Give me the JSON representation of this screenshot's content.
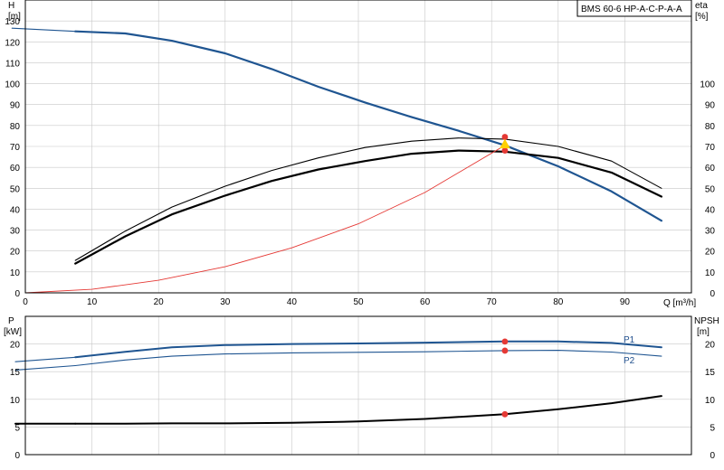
{
  "model_label": "BMS 60-6 HP-A-C-P-A-A",
  "colors": {
    "head": "#1f5591",
    "power": "#1f5591",
    "eta": "#000000",
    "npsh": "#000000",
    "system": "#e53935",
    "grid": "#c8c8c8",
    "duty_point": "#e53935",
    "duty_highlight": "#ffd000"
  },
  "chart_data": [
    {
      "type": "line",
      "title": "",
      "x_label": "Q [m³/h]",
      "y_label_left": "H\n[m]",
      "y_label_right": "eta\n[%]",
      "xlim": [
        0,
        100
      ],
      "ylim_left": [
        0,
        140
      ],
      "ylim_right": [
        0,
        140
      ],
      "x_ticks": [
        0,
        10,
        20,
        30,
        40,
        50,
        60,
        70,
        80,
        90
      ],
      "y_ticks_left": [
        0,
        10,
        20,
        30,
        40,
        50,
        60,
        70,
        80,
        90,
        100,
        110,
        120,
        130
      ],
      "y_ticks_right": [
        0,
        10,
        20,
        30,
        40,
        50,
        60,
        70,
        80,
        90,
        100
      ],
      "grid": true,
      "series": [
        {
          "key": "head_extended",
          "axis": "left",
          "style": "head_thin",
          "x": [
            -2,
            7.5
          ],
          "y": [
            126.5,
            125
          ]
        },
        {
          "key": "head",
          "axis": "left",
          "style": "head",
          "x": [
            7.5,
            15,
            22,
            30,
            37,
            44,
            51,
            58,
            65,
            72,
            80,
            88,
            95.5
          ],
          "y": [
            125,
            124,
            120.5,
            114.5,
            107,
            98.5,
            91,
            84,
            77.5,
            70.5,
            60.5,
            48.5,
            34.5
          ]
        },
        {
          "key": "eta_upper",
          "axis": "right",
          "style": "eta_thin",
          "x": [
            7.5,
            15,
            22,
            30,
            37,
            44,
            51,
            58,
            65,
            72,
            80,
            88,
            95.5
          ],
          "y": [
            15.5,
            29.5,
            41,
            51,
            58.5,
            64.5,
            69.5,
            72.5,
            74,
            73.5,
            70,
            63,
            50
          ]
        },
        {
          "key": "eta_lower",
          "axis": "right",
          "style": "eta",
          "x": [
            7.5,
            15,
            22,
            30,
            37,
            44,
            51,
            58,
            65,
            72,
            80,
            88,
            95.5
          ],
          "y": [
            14,
            27,
            37.5,
            46.5,
            53.5,
            59,
            63,
            66.5,
            68,
            67.5,
            64.5,
            57.5,
            46
          ]
        },
        {
          "key": "system",
          "axis": "left",
          "style": "system",
          "x": [
            0,
            10,
            20,
            30,
            40,
            50,
            60,
            72
          ],
          "y": [
            0,
            1.7,
            6,
            12.5,
            21.5,
            33,
            48,
            70.5
          ]
        }
      ],
      "points": [
        {
          "axis": "left",
          "x": 72,
          "y": 74.5,
          "style": "duty"
        },
        {
          "axis": "left",
          "x": 72,
          "y": 68,
          "style": "duty"
        },
        {
          "axis": "left",
          "x": 72,
          "y": 71,
          "style": "duty_highlight"
        }
      ]
    },
    {
      "type": "line",
      "title": "",
      "x_label": "",
      "y_label_left": "P\n[kW]",
      "y_label_right": "NPSH\n[m]",
      "xlim": [
        0,
        100
      ],
      "ylim_left": [
        0,
        25
      ],
      "ylim_right": [
        0,
        25
      ],
      "y_ticks_left": [
        0,
        5,
        10,
        15,
        20
      ],
      "y_ticks_right": [
        0,
        5,
        10,
        15,
        20
      ],
      "grid": true,
      "series": [
        {
          "key": "p1_extended",
          "axis": "left",
          "style": "power_thin",
          "x": [
            -1.5,
            7.5
          ],
          "y": [
            16.8,
            17.6
          ]
        },
        {
          "key": "p1",
          "axis": "left",
          "style": "power",
          "name": "P1",
          "x": [
            7.5,
            15,
            22,
            30,
            40,
            50,
            60,
            72,
            80,
            88,
            95.5
          ],
          "y": [
            17.6,
            18.6,
            19.4,
            19.8,
            20,
            20.1,
            20.25,
            20.45,
            20.45,
            20.2,
            19.4
          ]
        },
        {
          "key": "p2_extended",
          "axis": "left",
          "style": "power_thin",
          "x": [
            -1.5,
            7.5
          ],
          "y": [
            15.3,
            16.1
          ]
        },
        {
          "key": "p2",
          "axis": "left",
          "style": "power_thin",
          "name": "P2",
          "x": [
            7.5,
            15,
            22,
            30,
            40,
            50,
            60,
            72,
            80,
            88,
            95.5
          ],
          "y": [
            16.1,
            17.1,
            17.8,
            18.2,
            18.4,
            18.5,
            18.6,
            18.8,
            18.85,
            18.55,
            17.8
          ]
        },
        {
          "key": "npsh_extended",
          "axis": "left",
          "style": "npsh",
          "x": [
            -1.5,
            7.5
          ],
          "y": [
            5.6,
            5.6
          ]
        },
        {
          "key": "npsh",
          "axis": "left",
          "style": "npsh",
          "x": [
            7.5,
            15,
            22,
            30,
            40,
            50,
            60,
            72,
            80,
            88,
            95.5
          ],
          "y": [
            5.6,
            5.6,
            5.65,
            5.65,
            5.75,
            6.0,
            6.45,
            7.3,
            8.2,
            9.3,
            10.6
          ]
        }
      ],
      "points": [
        {
          "axis": "left",
          "x": 72,
          "y": 20.45,
          "style": "duty"
        },
        {
          "axis": "left",
          "x": 72,
          "y": 18.8,
          "style": "duty"
        },
        {
          "axis": "left",
          "x": 72,
          "y": 7.3,
          "style": "duty"
        }
      ]
    }
  ]
}
